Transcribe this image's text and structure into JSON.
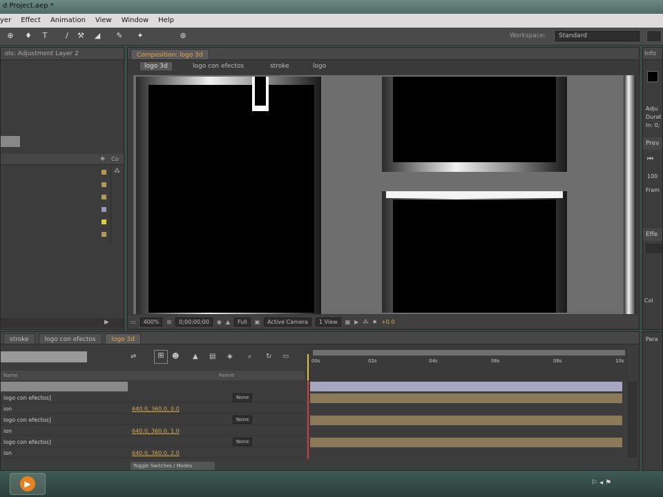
{
  "window": {
    "title": "d Project.aep *"
  },
  "menu": {
    "items": [
      "yer",
      "Effect",
      "Animation",
      "View",
      "Window",
      "Help"
    ]
  },
  "toolbar": {
    "workspace_label": "Workspace:",
    "workspace_value": "Standard"
  },
  "project_panel": {
    "title": "ols: Adjustment Layer 2",
    "col_label": "Co"
  },
  "composition": {
    "tab_label": "Composition: logo 3d",
    "breadcrumbs": [
      "logo 3d",
      "logo con efectos",
      "stroke",
      "logo"
    ],
    "camera_label": "Active Camera",
    "view_zoom": "400%",
    "timecode": "0;00;00;00",
    "resolution": "Full",
    "views": "1 View",
    "exposure": "+0.0"
  },
  "timeline": {
    "tabs": [
      "stroke",
      "logo con efectos",
      "logo 3d"
    ],
    "col_name": "Name",
    "col_parent": "Parent",
    "parent_none": "None",
    "ruler": [
      "00s",
      "02s",
      "04s",
      "06s",
      "08s",
      "10s"
    ],
    "toggle_label": "Toggle Switches / Modes",
    "rows": [
      {
        "name": "logo con efectos]",
        "kind": "layer"
      },
      {
        "name": "ion",
        "kind": "prop",
        "value": "640.0, 360.0, 0.0"
      },
      {
        "name": "logo con efectos]",
        "kind": "layer"
      },
      {
        "name": "ion",
        "kind": "prop",
        "value": "640.0, 360.0, 1.0"
      },
      {
        "name": "logo con efectos]",
        "kind": "layer"
      },
      {
        "name": "ion",
        "kind": "prop",
        "value": "640.0, 360.0, 2.0"
      }
    ]
  },
  "right_panel": {
    "info_label": "Info",
    "lines": [
      "Adju",
      "Durat",
      "In: 0;"
    ],
    "preview_label": "Prev",
    "preview_val": "100",
    "frame_label": "Fram",
    "effects_label": "Effe",
    "effects_item": "Col",
    "para_label": "Para"
  },
  "colors": {
    "accent": "#e8a64b",
    "label_yellow": "#c8b04a"
  }
}
